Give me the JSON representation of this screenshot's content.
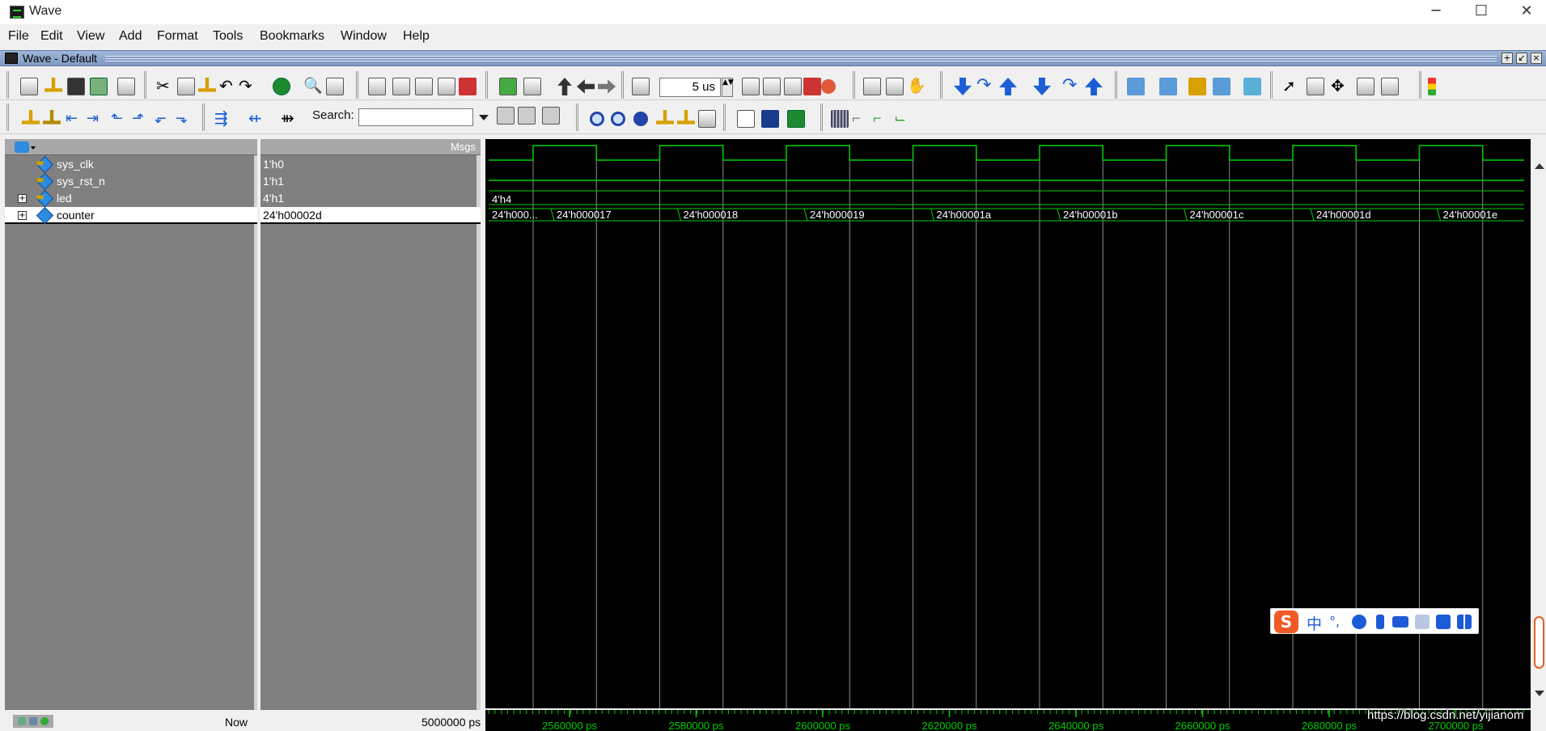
{
  "window": {
    "title": "Wave",
    "minimize_glyph": "─",
    "maximize_glyph": "☐",
    "close_glyph": "✕"
  },
  "menu": [
    "File",
    "Edit",
    "View",
    "Add",
    "Format",
    "Tools",
    "Bookmarks",
    "Window",
    "Help"
  ],
  "subwindow": {
    "title": "Wave - Default"
  },
  "toolbar": {
    "time_value": "5 us",
    "search_label": "Search:",
    "search_value": "",
    "spin_glyph": "▲▼"
  },
  "panels": {
    "msgs_header": "Msgs"
  },
  "signals": [
    {
      "name": "sys_clk",
      "value": "1'h0",
      "expandable": false,
      "selected": false
    },
    {
      "name": "sys_rst_n",
      "value": "1'h1",
      "expandable": false,
      "selected": false
    },
    {
      "name": "led",
      "value": "4'h1",
      "expandable": true,
      "selected": false
    },
    {
      "name": "counter",
      "value": "24'h00002d",
      "expandable": true,
      "selected": true
    }
  ],
  "waveform": {
    "led_value_label": "4'h4",
    "counter_labels": [
      "24'h000...",
      "24'h000017",
      "24'h000018",
      "24'h000019",
      "24'h00001a",
      "24'h00001b",
      "24'h00001c",
      "24'h00001d",
      "24'h00001e"
    ],
    "timeline_labels": [
      "2560000 ps",
      "2580000 ps",
      "2600000 ps",
      "2620000 ps",
      "2640000 ps",
      "2660000 ps",
      "2680000 ps",
      "2700000 ps"
    ],
    "signal_color": "#00d000"
  },
  "status": {
    "now_label": "Now",
    "now_time": "5000000 ps"
  },
  "watermark": "https://blog.csdn.net/yijianom",
  "ime": {
    "logo": "S",
    "mode": "中",
    "punct": "°,"
  },
  "colors": {
    "wave_bg": "#000000",
    "panel_grey": "#808080",
    "mdi_title": "#8fa8cc"
  }
}
